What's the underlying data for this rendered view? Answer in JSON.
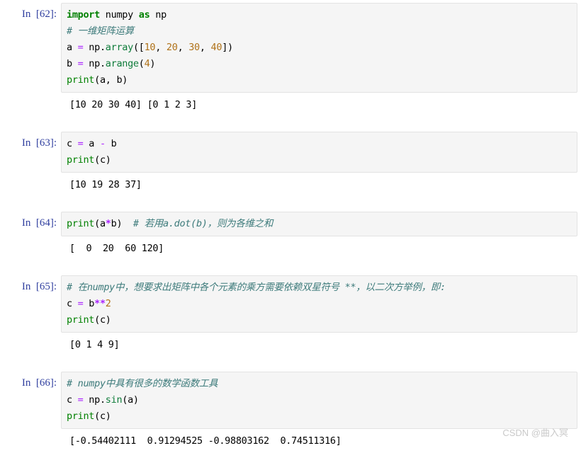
{
  "notebook": {
    "cells": [
      {
        "prompt": "In  [62]:",
        "code_lines": [
          [
            {
              "t": "import",
              "c": "kw"
            },
            {
              "t": " numpy ",
              "c": "name"
            },
            {
              "t": "as",
              "c": "kw"
            },
            {
              "t": " np",
              "c": "name"
            }
          ],
          [
            {
              "t": "# 一维矩阵运算",
              "c": "comment"
            }
          ],
          [
            {
              "t": "a ",
              "c": "name"
            },
            {
              "t": "=",
              "c": "op"
            },
            {
              "t": " np",
              "c": "name"
            },
            {
              "t": ".",
              "c": "punc"
            },
            {
              "t": "array",
              "c": "func"
            },
            {
              "t": "([",
              "c": "punc"
            },
            {
              "t": "10",
              "c": "num"
            },
            {
              "t": ", ",
              "c": "punc"
            },
            {
              "t": "20",
              "c": "num"
            },
            {
              "t": ", ",
              "c": "punc"
            },
            {
              "t": "30",
              "c": "num"
            },
            {
              "t": ", ",
              "c": "punc"
            },
            {
              "t": "40",
              "c": "num"
            },
            {
              "t": "])",
              "c": "punc"
            }
          ],
          [
            {
              "t": "b ",
              "c": "name"
            },
            {
              "t": "=",
              "c": "op"
            },
            {
              "t": " np",
              "c": "name"
            },
            {
              "t": ".",
              "c": "punc"
            },
            {
              "t": "arange",
              "c": "func"
            },
            {
              "t": "(",
              "c": "punc"
            },
            {
              "t": "4",
              "c": "num"
            },
            {
              "t": ")",
              "c": "punc"
            }
          ],
          [
            {
              "t": "print",
              "c": "builtin"
            },
            {
              "t": "(a, b)",
              "c": "punc"
            }
          ]
        ],
        "output_lines": [
          "[10 20 30 40] [0 1 2 3]"
        ]
      },
      {
        "prompt": "In  [63]:",
        "code_lines": [
          [
            {
              "t": "c ",
              "c": "name"
            },
            {
              "t": "=",
              "c": "op"
            },
            {
              "t": " a ",
              "c": "name"
            },
            {
              "t": "-",
              "c": "op"
            },
            {
              "t": " b",
              "c": "name"
            }
          ],
          [
            {
              "t": "print",
              "c": "builtin"
            },
            {
              "t": "(c)",
              "c": "punc"
            }
          ]
        ],
        "output_lines": [
          "[10 19 28 37]"
        ]
      },
      {
        "prompt": "In  [64]:",
        "code_lines": [
          [
            {
              "t": "print",
              "c": "builtin"
            },
            {
              "t": "(a",
              "c": "punc"
            },
            {
              "t": "*",
              "c": "op-bold"
            },
            {
              "t": "b)",
              "c": "punc"
            },
            {
              "t": "  # 若用a.dot(b)，则为各维之和",
              "c": "comment"
            }
          ]
        ],
        "output_lines": [
          "[  0  20  60 120]"
        ]
      },
      {
        "prompt": "In  [65]:",
        "code_lines": [
          [
            {
              "t": "# 在numpy中，想要求出矩阵中各个元素的乘方需要依赖双星符号 **，以二次方举例，即:",
              "c": "comment"
            }
          ],
          [
            {
              "t": "c ",
              "c": "name"
            },
            {
              "t": "=",
              "c": "op"
            },
            {
              "t": " b",
              "c": "name"
            },
            {
              "t": "**",
              "c": "op-bold"
            },
            {
              "t": "2",
              "c": "num"
            }
          ],
          [
            {
              "t": "print",
              "c": "builtin"
            },
            {
              "t": "(c)",
              "c": "punc"
            }
          ]
        ],
        "output_lines": [
          "[0 1 4 9]"
        ]
      },
      {
        "prompt": "In  [66]:",
        "code_lines": [
          [
            {
              "t": "# numpy中具有很多的数学函数工具",
              "c": "comment"
            }
          ],
          [
            {
              "t": "c ",
              "c": "name"
            },
            {
              "t": "=",
              "c": "op"
            },
            {
              "t": " np",
              "c": "name"
            },
            {
              "t": ".",
              "c": "punc"
            },
            {
              "t": "sin",
              "c": "func"
            },
            {
              "t": "(a)",
              "c": "punc"
            }
          ],
          [
            {
              "t": "print",
              "c": "builtin"
            },
            {
              "t": "(c)",
              "c": "punc"
            }
          ]
        ],
        "output_lines": [
          "[-0.54402111  0.91294525 -0.98803162  0.74511316]"
        ]
      }
    ]
  },
  "watermark": {
    "text": "CSDN @曲入冥"
  }
}
